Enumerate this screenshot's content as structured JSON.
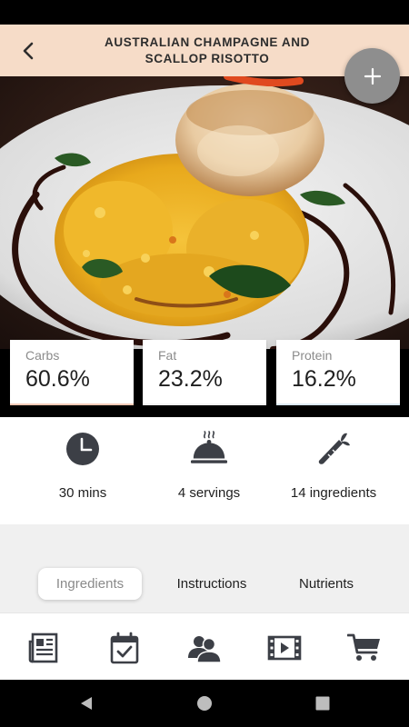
{
  "header": {
    "title": "AUSTRALIAN CHAMPAGNE AND SCALLOP RISOTTO",
    "back_icon": "chevron-left-icon",
    "add_icon": "plus-icon"
  },
  "hero": {
    "image": "plated scallop risotto photo"
  },
  "macros": [
    {
      "label": "Carbs",
      "value": "60.6%"
    },
    {
      "label": "Fat",
      "value": "23.2%"
    },
    {
      "label": "Protein",
      "value": "16.2%"
    }
  ],
  "stats": [
    {
      "icon": "clock-icon",
      "label": "30 mins"
    },
    {
      "icon": "cloche-icon",
      "label": "4 servings"
    },
    {
      "icon": "carrot-icon",
      "label": "14 ingredients"
    }
  ],
  "tabs": [
    {
      "label": "Ingredients",
      "active": true
    },
    {
      "label": "Instructions",
      "active": false
    },
    {
      "label": "Nutrients",
      "active": false
    }
  ],
  "bottom_nav": [
    {
      "icon": "newspaper-icon"
    },
    {
      "icon": "calendar-check-icon"
    },
    {
      "icon": "users-icon"
    },
    {
      "icon": "video-icon"
    },
    {
      "icon": "cart-icon"
    }
  ],
  "colors": {
    "header_bg": "#f6dcc8",
    "fab": "#8e8e8e",
    "icon_dark": "#3c3f46",
    "tabs_bg": "#f0f0f0"
  }
}
